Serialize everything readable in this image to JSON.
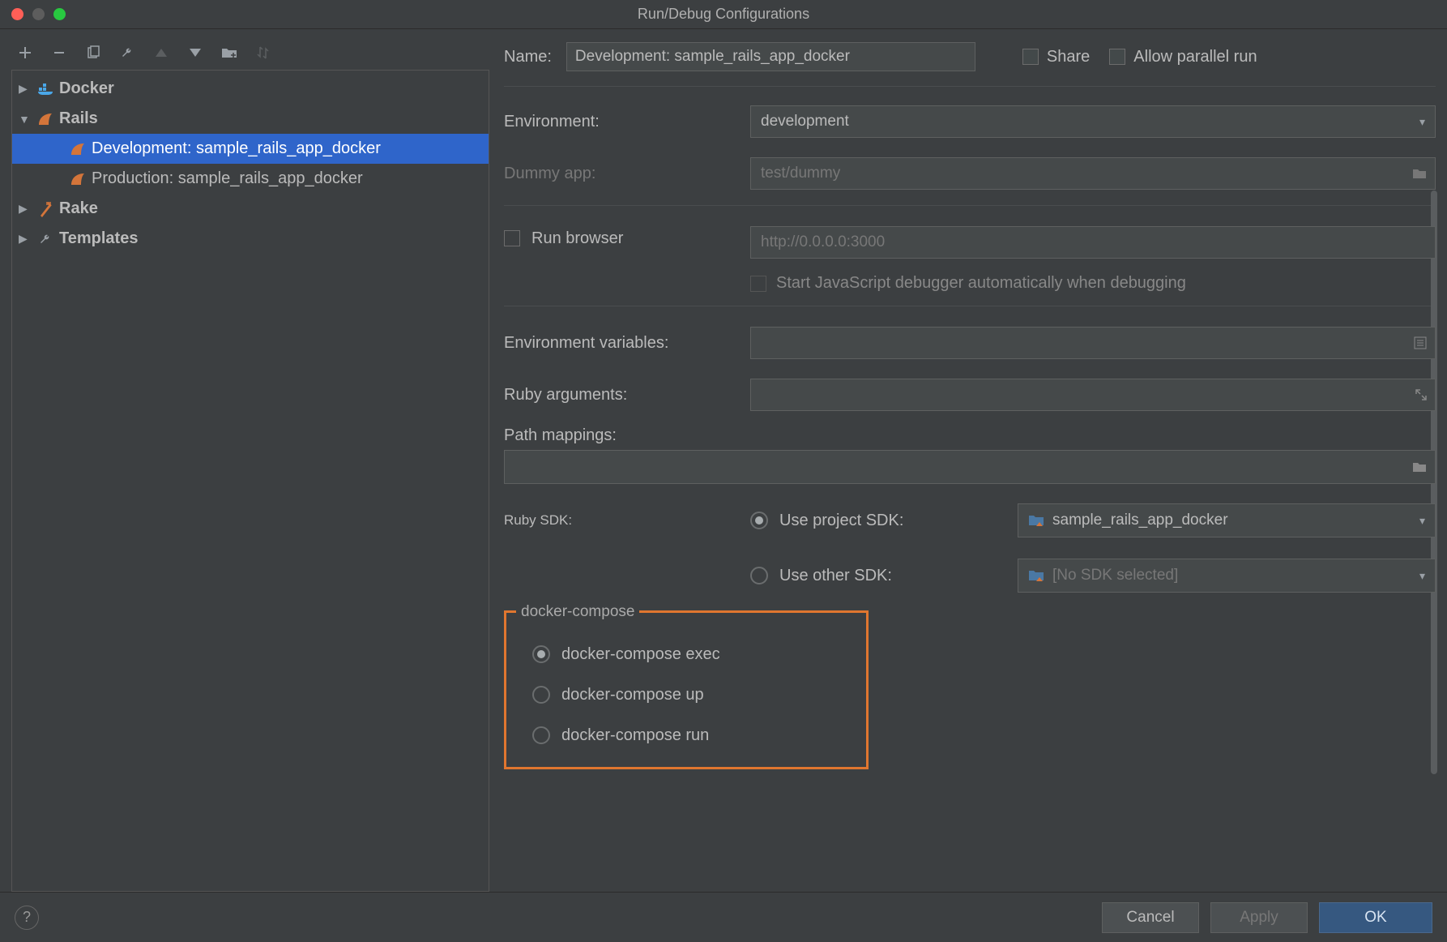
{
  "window": {
    "title": "Run/Debug Configurations"
  },
  "toolbar_icons": [
    "add",
    "remove",
    "copy",
    "wrench",
    "up",
    "down",
    "folder-add",
    "sort"
  ],
  "tree": {
    "docker": {
      "label": "Docker"
    },
    "rails": {
      "label": "Rails"
    },
    "rails_children": [
      {
        "label": "Development: sample_rails_app_docker",
        "selected": true
      },
      {
        "label": "Production: sample_rails_app_docker",
        "selected": false
      }
    ],
    "rake": {
      "label": "Rake"
    },
    "templates": {
      "label": "Templates"
    }
  },
  "name_row": {
    "label": "Name:",
    "value": "Development: sample_rails_app_docker",
    "share_label": "Share",
    "parallel_label": "Allow parallel run"
  },
  "form": {
    "environment_label": "Environment:",
    "environment_value": "development",
    "dummy_label": "Dummy app:",
    "dummy_value": "test/dummy",
    "run_browser_label": "Run browser",
    "run_browser_url": "http://0.0.0.0:3000",
    "start_js_label": "Start JavaScript debugger automatically when debugging",
    "env_vars_label": "Environment variables:",
    "ruby_args_label": "Ruby arguments:",
    "path_mappings_label": "Path mappings:",
    "ruby_sdk_label": "Ruby SDK:",
    "use_project_sdk": "Use project SDK:",
    "use_other_sdk": "Use other SDK:",
    "project_sdk_value": "sample_rails_app_docker",
    "other_sdk_value": "[No SDK selected]",
    "docker_compose_title": "docker-compose",
    "dc_options": [
      "docker-compose exec",
      "docker-compose up",
      "docker-compose run"
    ]
  },
  "buttons": {
    "cancel": "Cancel",
    "apply": "Apply",
    "ok": "OK"
  }
}
